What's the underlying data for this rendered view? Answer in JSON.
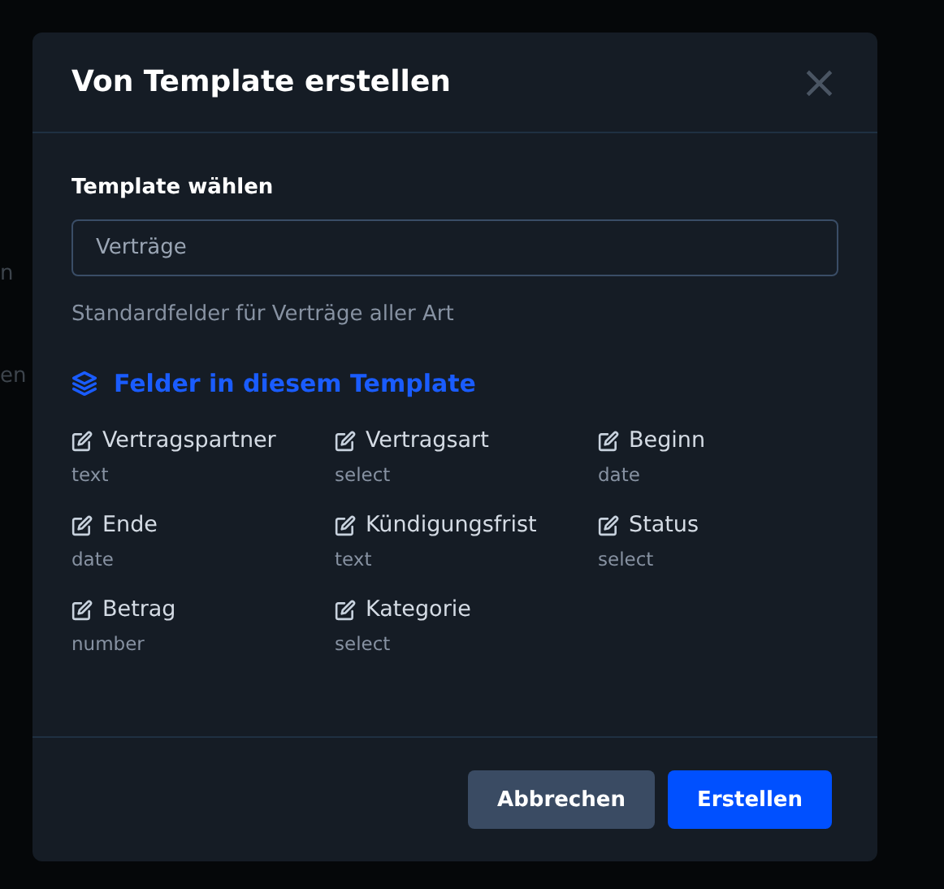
{
  "background": {
    "fragments": [
      "n",
      "en"
    ]
  },
  "dialog": {
    "title": "Von Template erstellen",
    "close_symbol": "×",
    "template_label": "Template wählen",
    "template_value": "Verträge",
    "description": "Standardfelder für Verträge aller Art",
    "fields_heading": "Felder in diesem Template",
    "fields": [
      {
        "name": "Vertragspartner",
        "type": "text"
      },
      {
        "name": "Vertragsart",
        "type": "select"
      },
      {
        "name": "Beginn",
        "type": "date"
      },
      {
        "name": "Ende",
        "type": "date"
      },
      {
        "name": "Kündigungsfrist",
        "type": "text"
      },
      {
        "name": "Status",
        "type": "select"
      },
      {
        "name": "Betrag",
        "type": "number"
      },
      {
        "name": "Kategorie",
        "type": "select"
      }
    ],
    "buttons": [
      {
        "label": "Abbrechen",
        "kind": "secondary"
      },
      {
        "label": "Erstellen",
        "kind": "primary"
      }
    ]
  }
}
